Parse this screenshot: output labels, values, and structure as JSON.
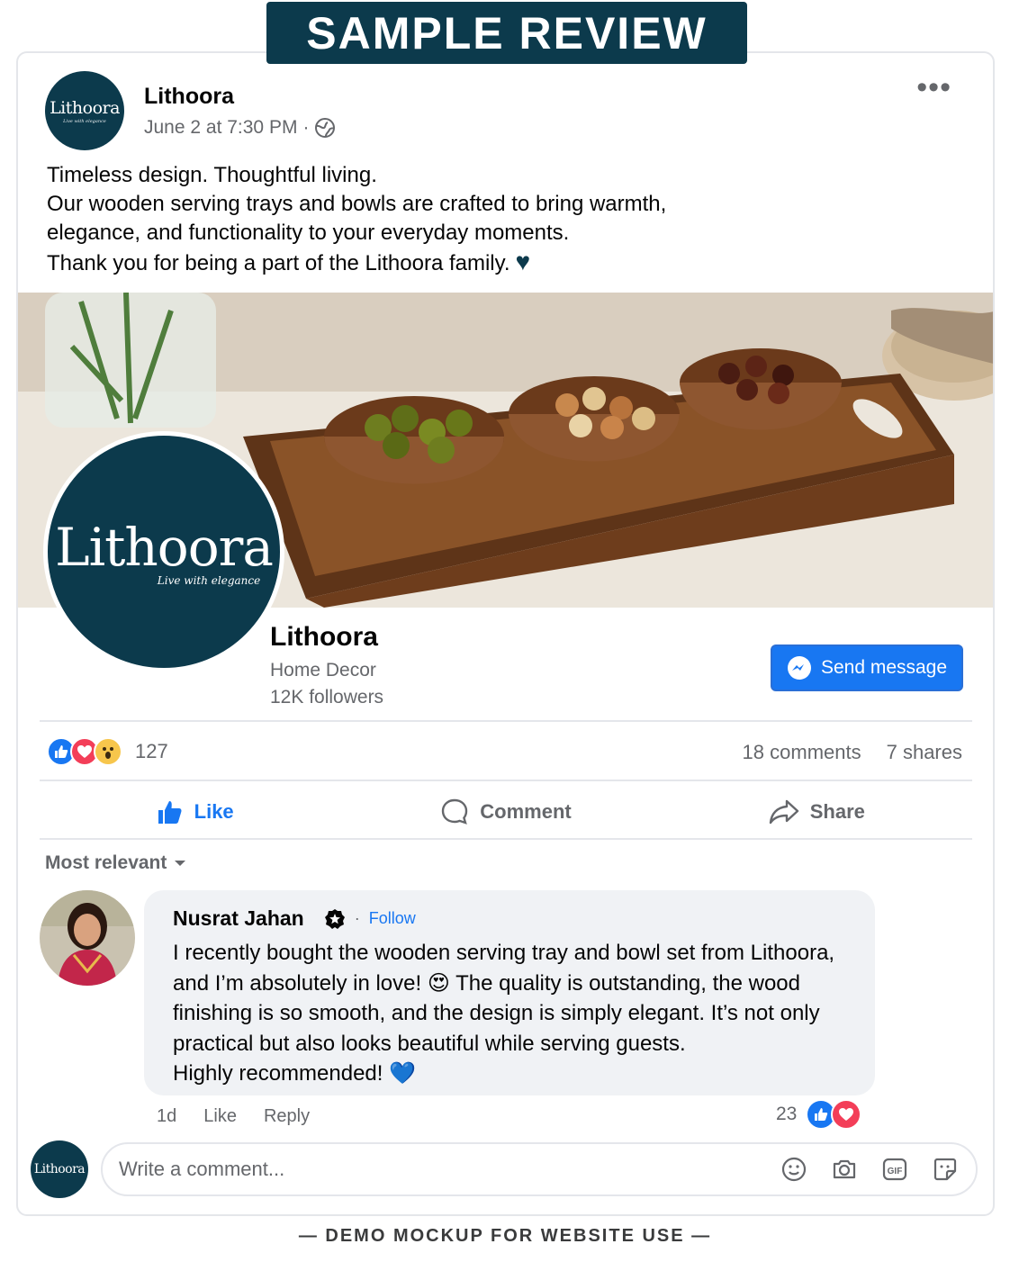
{
  "banner": {
    "label": "SAMPLE REVIEW"
  },
  "post": {
    "author": "Lithoora",
    "date": "June 2 at 7:30 PM",
    "meta_sep": "·",
    "more_label": "•••",
    "lines": [
      "Timeless design. Thoughtful living.",
      "Our wooden serving trays and bowls are crafted to bring warmth,",
      "elegance, and functionality to your everyday moments.",
      "Thank you for being a part of the Lithoora family."
    ],
    "heart": "♥"
  },
  "logo": {
    "text": "Lithoora",
    "tagline": "Live with elegance"
  },
  "page_card": {
    "name": "Lithoora",
    "category": "Home Decor",
    "followers": "12K followers",
    "send_label": "Send message"
  },
  "stats": {
    "reaction_count": "127",
    "comments": "18 comments",
    "shares": "7 shares"
  },
  "actions": {
    "like": "Like",
    "comment": "Comment",
    "share": "Share"
  },
  "sort_label": "Most relevant",
  "comment": {
    "name": "Nusrat Jahan",
    "dot": "·",
    "follow": "Follow",
    "lines": [
      "I recently bought the wooden serving tray and bowl set from Lithoora,",
      "and I’m absolutely in love!",
      "The quality is outstanding, the wood",
      "finishing is so smooth, and the design is simply elegant. It’s not only",
      "practical but also looks beautiful while serving guests.",
      "Highly recommended!"
    ],
    "emoji_love": "😍",
    "heart": "💙",
    "time": "1d",
    "like": "Like",
    "reply": "Reply",
    "reaction_count": "23"
  },
  "composer": {
    "placeholder": "Write a comment..."
  },
  "footer_note": "— DEMO MOCKUP FOR WEBSITE USE —",
  "colors": {
    "brand": "#0c3a4c",
    "facebook_blue": "#1877f2",
    "love_red": "#f33e58"
  }
}
